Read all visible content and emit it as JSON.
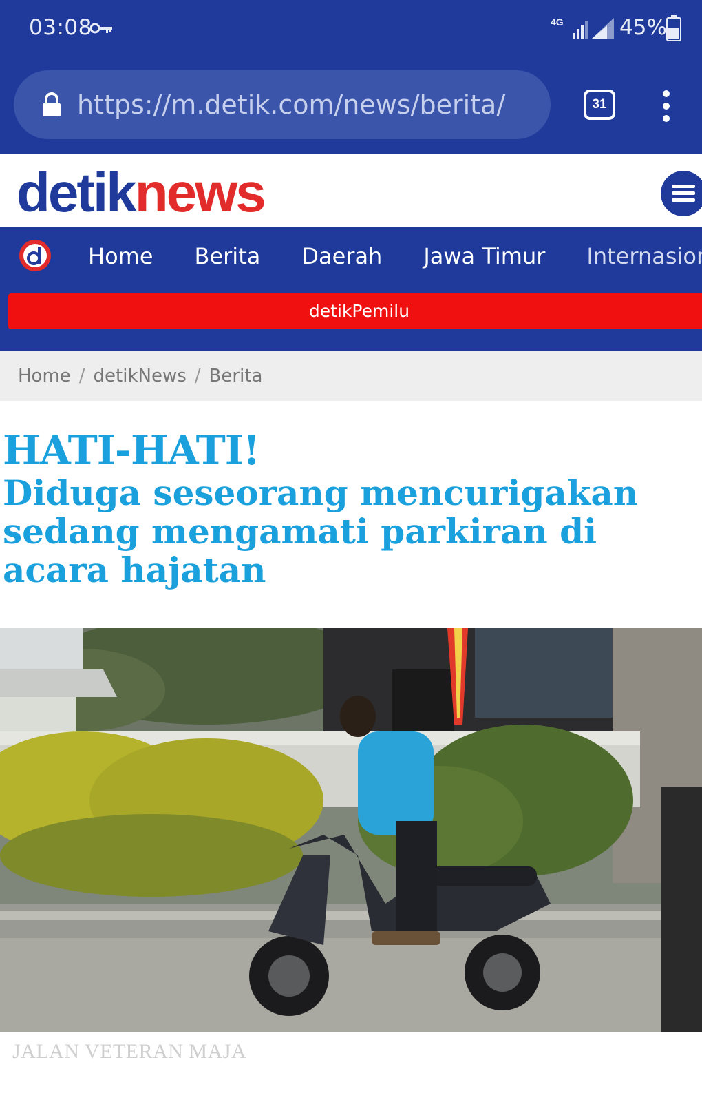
{
  "status_bar": {
    "time": "03:08",
    "network": "4G",
    "battery": "45%"
  },
  "browser": {
    "url": "https://m.detik.com/news/berita/",
    "tab_count": "31"
  },
  "site": {
    "logo_part1": "detik",
    "logo_part2": "news",
    "brand_blue": "#1f3a9a",
    "brand_red": "#e22b2b"
  },
  "nav": {
    "items": [
      "Home",
      "Berita",
      "Daerah",
      "Jawa Timur",
      "Internasional"
    ],
    "promo_bar": "detikPemilu"
  },
  "breadcrumb": {
    "items": [
      "Home",
      "detikNews",
      "Berita"
    ]
  },
  "article": {
    "kicker": "HATI-HATI!",
    "title_line1": "Diduga seseorang mencurigakan",
    "title_line2": "sedang mengamati parkiran di",
    "title_line3": "acara hajatan",
    "headline_color": "#1aa0dc"
  },
  "photo": {
    "caption": "JALAN VETERAN MAJA"
  }
}
